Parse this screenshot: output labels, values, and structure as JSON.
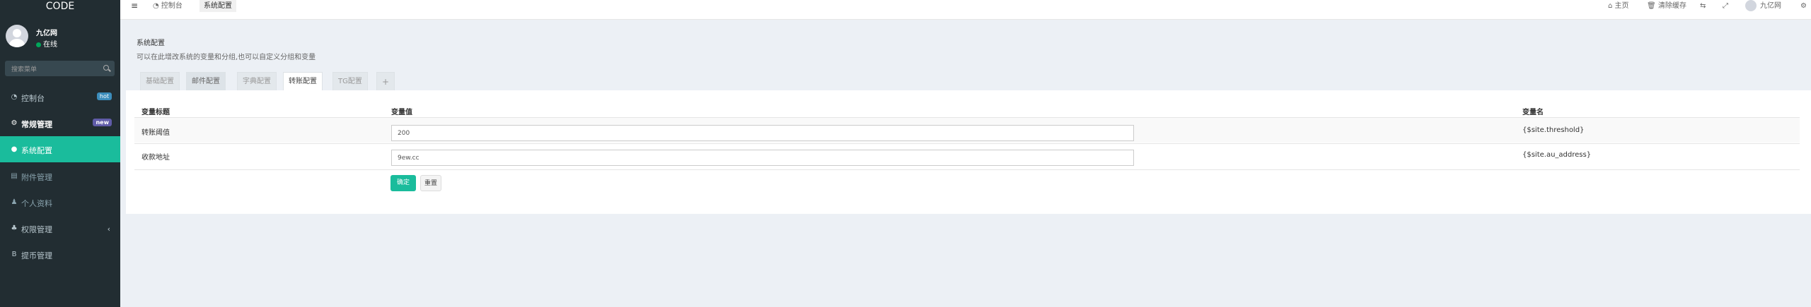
{
  "sidebar": {
    "logo": "CODE",
    "user": {
      "name": "九亿网",
      "status": "在线"
    },
    "search_placeholder": "搜索菜单",
    "items": [
      {
        "label": "控制台",
        "badge": "hot"
      },
      {
        "label": "常规管理",
        "badge": "new"
      },
      {
        "label": "系统配置"
      },
      {
        "label": "附件管理"
      },
      {
        "label": "个人资料"
      },
      {
        "label": "权限管理"
      },
      {
        "label": "提币管理"
      }
    ]
  },
  "topbar": {
    "tabs": [
      {
        "label": "控制台"
      },
      {
        "label": "系统配置"
      }
    ],
    "right": {
      "home": "主页",
      "clear_cache": "清除缓存",
      "username": "九亿网"
    }
  },
  "content": {
    "title": "系统配置",
    "description": "可以在此增改系统的变量和分组,也可以自定义分组和变量",
    "tabs": [
      {
        "label": "基础配置"
      },
      {
        "label": "邮件配置"
      },
      {
        "label": "字典配置"
      },
      {
        "label": "转账配置"
      },
      {
        "label": "TG配置"
      },
      {
        "label": "+"
      }
    ],
    "table": {
      "headers": {
        "title": "变量标题",
        "value": "变量值",
        "name": "变量名"
      },
      "rows": [
        {
          "title": "转账阈值",
          "value": "200",
          "name": "{$site.threshold}"
        },
        {
          "title": "收款地址",
          "value": "9ew.cc",
          "name": "{$site.au_address}"
        }
      ]
    },
    "buttons": {
      "ok": "确定",
      "reset": "重置"
    }
  },
  "colors": {
    "sidebar_bg": "#222d32",
    "accent": "#1abc9c",
    "page_bg": "#ecf0f5"
  }
}
